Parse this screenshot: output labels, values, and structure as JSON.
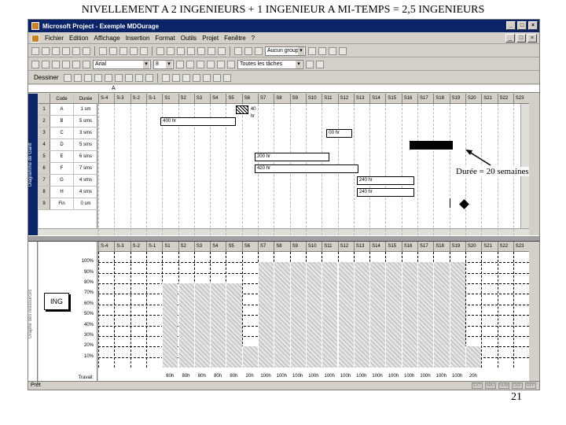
{
  "slide": {
    "title": "NIVELLEMENT A 2 INGENIEURS + 1 INGENIEUR A MI-TEMPS = 2,5 INGENIEURS",
    "page_number": "21"
  },
  "window": {
    "title": "Microsoft Project - Exemple MDOurage",
    "buttons": [
      "_",
      "□",
      "×"
    ]
  },
  "menu": [
    "Fichier",
    "Edition",
    "Affichage",
    "Insertion",
    "Format",
    "Outils",
    "Projet",
    "Fenêtre",
    "?"
  ],
  "toolbar1": {
    "zoom_combo": "Aucun groupe"
  },
  "toolbar2": {
    "font_combo": "Arial",
    "size_combo": "8",
    "filter_combo": "Toutes les tâches"
  },
  "toolbar3": {
    "draw_label": "Dessiner"
  },
  "editbar": {
    "value": "A"
  },
  "viewbar": {
    "top_caption": "Diagramme de Gantt",
    "bottom_caption": "Graphe des ressources"
  },
  "task_table": {
    "headers": [
      "",
      "Code",
      "Durée"
    ],
    "rows": [
      {
        "num": "1",
        "code": "A",
        "duration": "1 sm"
      },
      {
        "num": "2",
        "code": "B",
        "duration": "5 sms"
      },
      {
        "num": "3",
        "code": "C",
        "duration": "3 sms"
      },
      {
        "num": "4",
        "code": "D",
        "duration": "5 sms"
      },
      {
        "num": "5",
        "code": "E",
        "duration": "6 sms"
      },
      {
        "num": "6",
        "code": "F",
        "duration": "7 sms"
      },
      {
        "num": "7",
        "code": "G",
        "duration": "4 sms"
      },
      {
        "num": "8",
        "code": "H",
        "duration": "4 sms"
      },
      {
        "num": "9",
        "code": "Fin",
        "duration": "0 sm"
      }
    ]
  },
  "timescale": [
    "S-4",
    "S-3",
    "S-2",
    "S-1",
    "S1",
    "S2",
    "S3",
    "S4",
    "S5",
    "S6",
    "S7",
    "S8",
    "S9",
    "S10",
    "S11",
    "S12",
    "S13",
    "S14",
    "S15",
    "S16",
    "S17",
    "S18",
    "S19",
    "S20",
    "S21",
    "S22",
    "S23",
    "S24"
  ],
  "gantt_bars": [
    {
      "label": "40 hr",
      "style": "hatch"
    },
    {
      "label": "400 hr",
      "style": "white"
    },
    {
      "label": "00 hr",
      "style": "white"
    },
    {
      "label": "",
      "style": "black"
    },
    {
      "label": "200 hr",
      "style": "white"
    },
    {
      "label": "420 hr",
      "style": "white"
    },
    {
      "label": "240 hr",
      "style": "white"
    },
    {
      "label": "240 hr",
      "style": "white"
    }
  ],
  "annotation": "Durée = 20 semaines",
  "resource": {
    "name": "ING",
    "y_labels": [
      "100%",
      "90%",
      "80%",
      "70%",
      "60%",
      "50%",
      "40%",
      "30%",
      "20%",
      "10%"
    ],
    "row_label": "Travail:",
    "histogram": [
      0,
      0,
      0,
      0,
      80,
      80,
      80,
      80,
      80,
      20,
      100,
      100,
      100,
      100,
      100,
      100,
      100,
      100,
      100,
      100,
      100,
      100,
      100,
      20,
      0,
      0,
      0
    ],
    "bottom_values": [
      "80h",
      "80h",
      "80h",
      "80h",
      "80h",
      "20h",
      "100h",
      "100h",
      "100h",
      "100h",
      "100h",
      "100h",
      "100h",
      "100h",
      "100h",
      "100h",
      "100h",
      "100h",
      "100h",
      "20h"
    ]
  },
  "status": {
    "text": "Prêt",
    "slots": [
      "EXT",
      "MAJ",
      "NUM",
      "DEF",
      "RFP"
    ]
  }
}
